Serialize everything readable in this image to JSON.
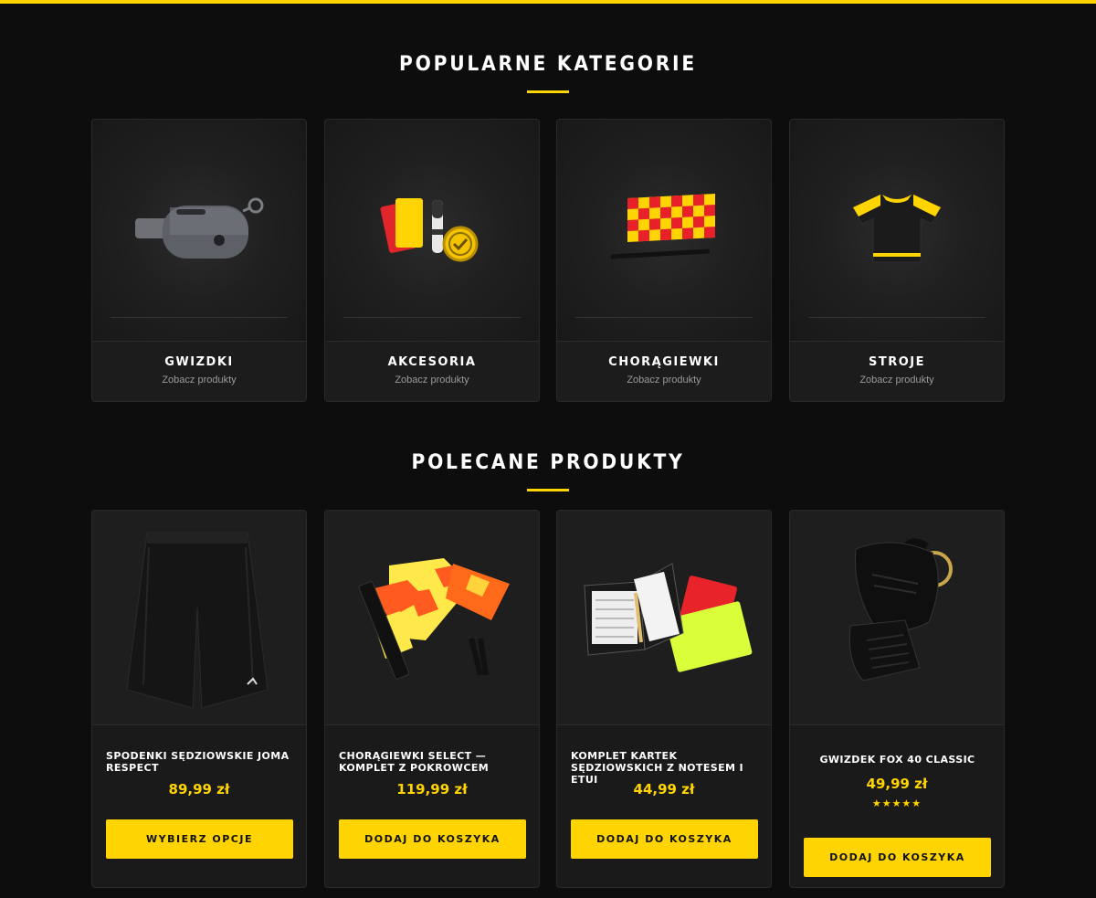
{
  "popular_categories": {
    "title": "POPULARNE KATEGORIE",
    "items": [
      {
        "name": "GWIZDKI",
        "link": "Zobacz produkty",
        "icon": "whistle-icon"
      },
      {
        "name": "AKCESORIA",
        "link": "Zobacz produkty",
        "icon": "referee-accessories-icon"
      },
      {
        "name": "CHORĄGIEWKI",
        "link": "Zobacz produkty",
        "icon": "checkered-flag-icon"
      },
      {
        "name": "STROJE",
        "link": "Zobacz produkty",
        "icon": "jersey-icon"
      }
    ]
  },
  "featured_products": {
    "title": "POLECANE PRODUKTY",
    "items": [
      {
        "name": "SPODENKI SĘDZIOWSKIE JOMA RESPECT",
        "price": "89,99 zł",
        "button": "WYBIERZ OPCJE",
        "image": "black-shorts-image"
      },
      {
        "name": "CHORĄGIEWKI SELECT — KOMPLET Z POKROWCEM",
        "price": "119,99 zł",
        "button": "DODAJ DO KOSZYKA",
        "image": "select-flags-image"
      },
      {
        "name": "KOMPLET KARTEK SĘDZIOWSKICH Z NOTESEM I ETUI",
        "price": "44,99 zł",
        "button": "DODAJ DO KOSZYKA",
        "image": "referee-cards-wallet-image"
      },
      {
        "name": "GWIZDEK FOX 40 CLASSIC",
        "price": "49,99 zł",
        "rating": 5,
        "button": "DODAJ DO KOSZYKA",
        "image": "fox40-whistle-image"
      }
    ]
  },
  "colors": {
    "accent": "#ffd400",
    "background": "#0d0d0d",
    "card": "#1a1a1a"
  }
}
